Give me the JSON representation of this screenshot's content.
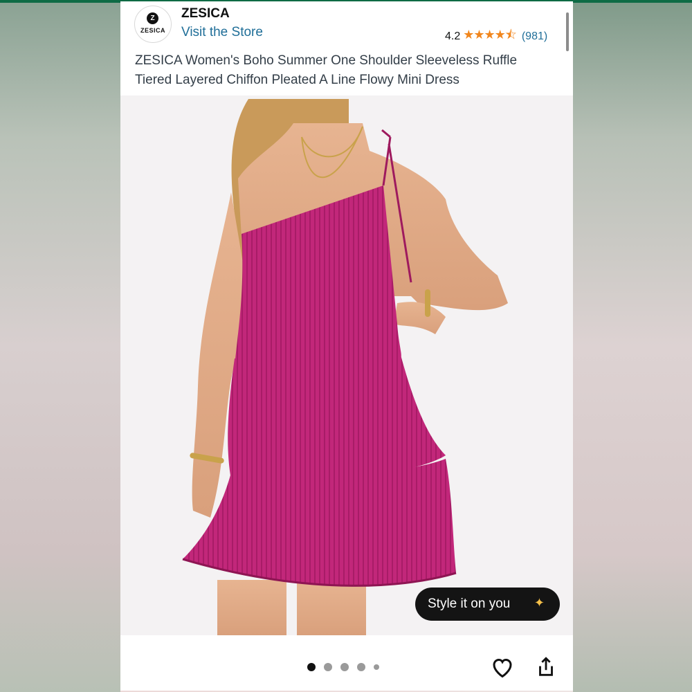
{
  "brand": {
    "logo_text": "ZESICA",
    "logo_mark": "Z",
    "name": "ZESICA",
    "visit_store": "Visit the Store"
  },
  "rating": {
    "value": "4.2",
    "stars": "★★★★⯪",
    "count": "(981)",
    "star_color": "#f1861d"
  },
  "product": {
    "title": "ZESICA Women's Boho Summer One Shoulder Sleeveless Ruffle Tiered Layered Chiffon Pleated A Line Flowy Mini Dress",
    "dress_color": "#c2277a"
  },
  "style_button": {
    "label": "Style it on you",
    "icon": "sparkle-icon"
  },
  "carousel": {
    "total_images": 5,
    "active_index": 0
  },
  "actions": {
    "wishlist_icon": "heart-icon",
    "share_icon": "share-icon"
  }
}
